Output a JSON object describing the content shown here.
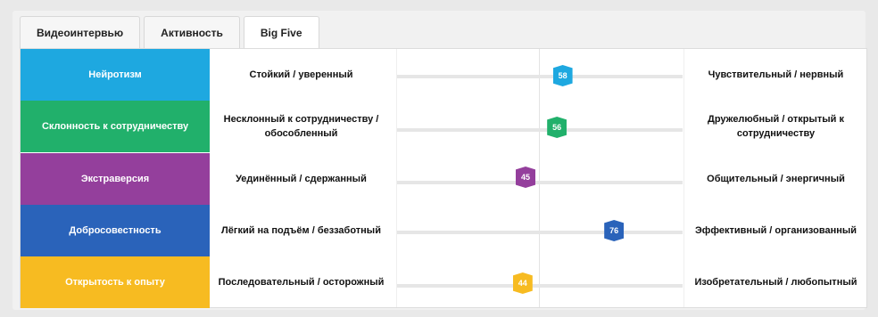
{
  "tabs": [
    {
      "label": "Видеоинтервью"
    },
    {
      "label": "Активность"
    },
    {
      "label": "Big Five"
    }
  ],
  "rows": [
    {
      "trait": "Нейротизм",
      "color": "#1ea8e0",
      "low": "Стойкий / уверенный",
      "high": "Чувствительный / нервный",
      "score": "58",
      "score_value": 58
    },
    {
      "trait": "Склонность к сотрудничеству",
      "color": "#21b06b",
      "low": "Несклонный к сотрудничеству / обособленный",
      "high": "Дружелюбный / открытый к сотрудничеству",
      "score": "56",
      "score_value": 56
    },
    {
      "trait": "Экстраверсия",
      "color": "#943f9c",
      "low": "Уединённый / сдержанный",
      "high": "Общительный / энергичный",
      "score": "45",
      "score_value": 45
    },
    {
      "trait": "Добросовестность",
      "color": "#2a63ba",
      "low": "Лёгкий на подъём / беззаботный",
      "high": "Эффективный / организованный",
      "score": "76",
      "score_value": 76
    },
    {
      "trait": "Открытость к опыту",
      "color": "#f7bb21",
      "low": "Последовательный / осторожный",
      "high": "Изобретательный / любопытный",
      "score": "44",
      "score_value": 44
    }
  ]
}
